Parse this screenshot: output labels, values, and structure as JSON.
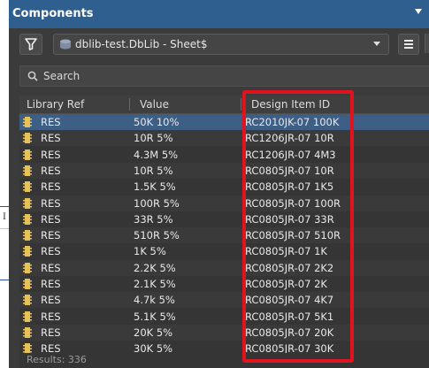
{
  "panel": {
    "title": "Components",
    "library": "dblib-test.DbLib - Sheet$",
    "search_placeholder": "Search",
    "columns": [
      "Library Ref",
      "Value",
      "Design Item ID"
    ],
    "rows": [
      {
        "lib_ref": "RES",
        "value": "50K  10%",
        "design_id": "RC2010JK-07 100K"
      },
      {
        "lib_ref": "RES",
        "value": "10R 5%",
        "design_id": "RC1206JR-07 10R"
      },
      {
        "lib_ref": "RES",
        "value": "4.3M  5%",
        "design_id": "RC1206JR-07 4M3"
      },
      {
        "lib_ref": "RES",
        "value": "10R 5%",
        "design_id": "RC0805JR-07 10R"
      },
      {
        "lib_ref": "RES",
        "value": "1.5K 5%",
        "design_id": "RC0805JR-07 1K5"
      },
      {
        "lib_ref": "RES",
        "value": "100R 5%",
        "design_id": "RC0805JR-07 100R"
      },
      {
        "lib_ref": "RES",
        "value": "33R 5%",
        "design_id": "RC0805JR-07 33R"
      },
      {
        "lib_ref": "RES",
        "value": "510R 5%",
        "design_id": "RC0805JR-07 510R"
      },
      {
        "lib_ref": "RES",
        "value": "1K 5%",
        "design_id": "RC0805JR-07 1K"
      },
      {
        "lib_ref": "RES",
        "value": "2.2K 5%",
        "design_id": "RC0805JR-07 2K2"
      },
      {
        "lib_ref": "RES",
        "value": "2.1K 5%",
        "design_id": "RC0805JR-07 2K"
      },
      {
        "lib_ref": "RES",
        "value": "4.7k 5%",
        "design_id": "RC0805JR-07 4K7"
      },
      {
        "lib_ref": "RES",
        "value": "5.1K 5%",
        "design_id": "RC0805JR-07 5K1"
      },
      {
        "lib_ref": "RES",
        "value": "20K 5%",
        "design_id": "RC0805JR-07 20K"
      },
      {
        "lib_ref": "RES",
        "value": "30K  5%",
        "design_id": "RC0805JR-07 30K"
      }
    ],
    "status_text": "Results: 336"
  },
  "colors": {
    "titlebar": "#2f5f8f",
    "panel_bg": "#3b3b3b",
    "selected_row": "#3d5f85",
    "highlight": "#e0141e",
    "component_icon": "#e5c15a"
  }
}
